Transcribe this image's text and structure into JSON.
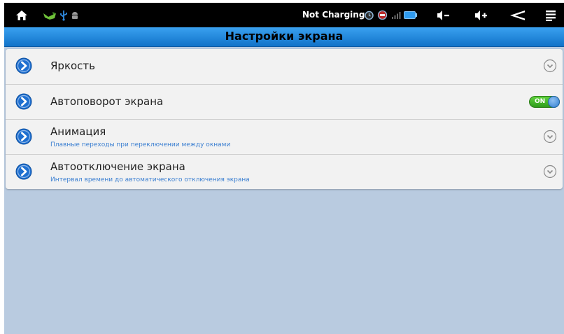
{
  "status_bar": {
    "icons": [
      "home-icon",
      "notification-icon",
      "usb-icon",
      "android-debug-icon",
      "alarm-icon",
      "battery-warning-icon",
      "signal-icon",
      "battery-icon",
      "volume-down-icon",
      "volume-up-icon",
      "back-icon",
      "menu-icon"
    ],
    "charging_text": "Not Charging"
  },
  "header": {
    "title": "Настройки экрана"
  },
  "settings": {
    "items": [
      {
        "title": "Яркость",
        "subtitle": ""
      },
      {
        "title": "Автоповорот экрана",
        "subtitle": "",
        "toggle": {
          "label": "ON",
          "state": true
        }
      },
      {
        "title": "Анимация",
        "subtitle": "Плавные переходы при переключении между окнами"
      },
      {
        "title": "Автоотключение экрана",
        "subtitle": "Интервал времени до автоматического отключения экрана"
      }
    ]
  },
  "colors": {
    "status_bar": "#000000",
    "title_bar": "#2a8ee0",
    "list_background": "#f2f2f2",
    "content_background": "#b9cbe0",
    "subtitle_text": "#3b7fd1",
    "toggle_on": "#4cc12e",
    "accent_blue": "#1e6fd0"
  }
}
